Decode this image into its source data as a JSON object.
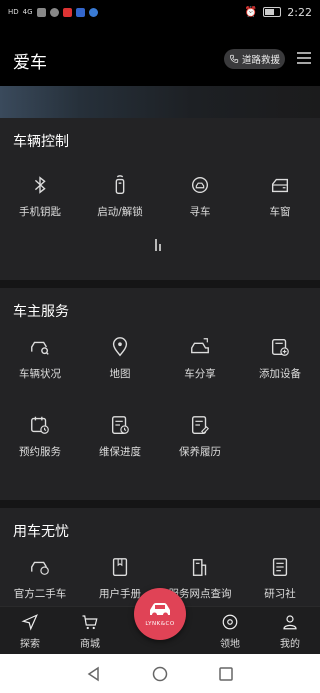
{
  "status_bar": {
    "left_indicators": [
      "HD",
      "4G"
    ],
    "time": "2:22"
  },
  "header": {
    "title": "爱车",
    "rescue_label": "道路救援"
  },
  "sections": [
    {
      "title": "车辆控制",
      "items": [
        {
          "label": "手机钥匙",
          "icon": "bluetooth-key-icon"
        },
        {
          "label": "启动/解锁",
          "icon": "remote-start-icon"
        },
        {
          "label": "寻车",
          "icon": "find-car-icon"
        },
        {
          "label": "车窗",
          "icon": "car-window-icon"
        }
      ]
    },
    {
      "title": "车主服务",
      "items": [
        {
          "label": "车辆状况",
          "icon": "car-status-icon"
        },
        {
          "label": "地图",
          "icon": "map-pin-icon"
        },
        {
          "label": "车分享",
          "icon": "car-share-icon"
        },
        {
          "label": "添加设备",
          "icon": "add-device-icon"
        },
        {
          "label": "预约服务",
          "icon": "calendar-clock-icon"
        },
        {
          "label": "维保进度",
          "icon": "maintenance-progress-icon"
        },
        {
          "label": "保养履历",
          "icon": "maintenance-history-icon"
        }
      ]
    },
    {
      "title": "用车无忧",
      "items": [
        {
          "label": "官方二手车",
          "icon": "used-car-icon"
        },
        {
          "label": "用户手册",
          "icon": "manual-icon"
        },
        {
          "label": "服务网点查询",
          "icon": "service-station-icon"
        },
        {
          "label": "研习社",
          "icon": "study-club-icon"
        }
      ]
    }
  ],
  "bottom_nav": {
    "items": [
      {
        "label": "探索",
        "icon": "explore-icon"
      },
      {
        "label": "商城",
        "icon": "cart-icon"
      },
      {
        "label": "领地",
        "icon": "territory-icon"
      },
      {
        "label": "我的",
        "icon": "profile-icon"
      }
    ],
    "center_brand": "LYNK&CO"
  },
  "colors": {
    "accent": "#e04356",
    "background": "#1b1b1c",
    "card": "#232325"
  }
}
